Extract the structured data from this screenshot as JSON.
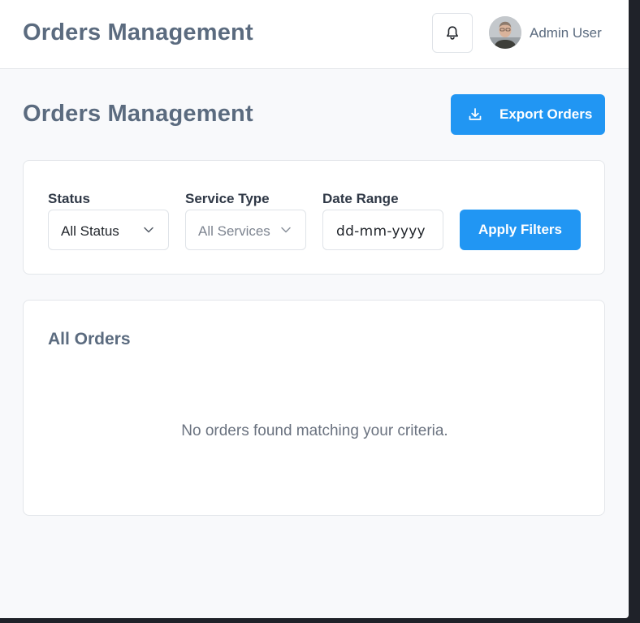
{
  "header": {
    "title": "Orders Management",
    "user_name": "Admin User",
    "bell_icon": "bell-icon",
    "avatar": "user-avatar"
  },
  "page": {
    "title": "Orders Management",
    "export_label": "Export Orders",
    "export_icon": "download-icon"
  },
  "filters": {
    "status": {
      "label": "Status",
      "value": "All Status"
    },
    "service_type": {
      "label": "Service Type",
      "value": "All Services"
    },
    "date_range": {
      "label": "Date Range",
      "placeholder": "dd-mm-yyyy"
    },
    "apply_label": "Apply Filters"
  },
  "orders": {
    "title": "All Orders",
    "empty_message": "No orders found matching your criteria."
  },
  "colors": {
    "accent": "#2196f3",
    "heading": "#5b6b7f",
    "background": "#f8f9fb"
  }
}
